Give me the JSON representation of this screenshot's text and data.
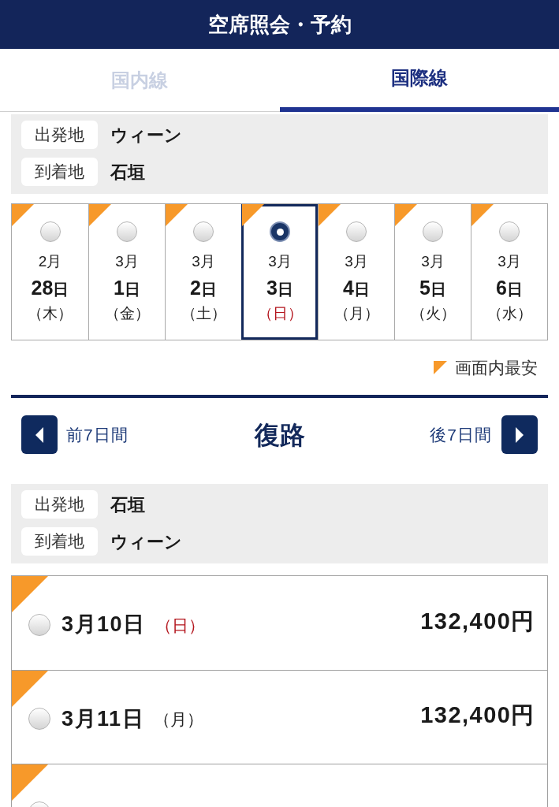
{
  "header": {
    "title": "空席照会・予約"
  },
  "tabs": [
    {
      "label": "国内線",
      "selected": false
    },
    {
      "label": "国際線",
      "selected": true
    }
  ],
  "outbound": {
    "route": [
      {
        "label": "出発地",
        "value": "ウィーン"
      },
      {
        "label": "到着地",
        "value": "石垣"
      }
    ],
    "dates": [
      {
        "month": "2月",
        "day": "28",
        "day_unit": "日",
        "weekday": "（木）",
        "holiday": false,
        "cheapest": true,
        "selected": false
      },
      {
        "month": "3月",
        "day": "1",
        "day_unit": "日",
        "weekday": "（金）",
        "holiday": false,
        "cheapest": true,
        "selected": false
      },
      {
        "month": "3月",
        "day": "2",
        "day_unit": "日",
        "weekday": "（土）",
        "holiday": false,
        "cheapest": true,
        "selected": false
      },
      {
        "month": "3月",
        "day": "3",
        "day_unit": "日",
        "weekday": "（日）",
        "holiday": true,
        "cheapest": true,
        "selected": true
      },
      {
        "month": "3月",
        "day": "4",
        "day_unit": "日",
        "weekday": "（月）",
        "holiday": false,
        "cheapest": true,
        "selected": false
      },
      {
        "month": "3月",
        "day": "5",
        "day_unit": "日",
        "weekday": "（火）",
        "holiday": false,
        "cheapest": true,
        "selected": false
      },
      {
        "month": "3月",
        "day": "6",
        "day_unit": "日",
        "weekday": "（水）",
        "holiday": false,
        "cheapest": true,
        "selected": false
      }
    ]
  },
  "legend": {
    "label": "画面内最安"
  },
  "return": {
    "prev": "前7日間",
    "title": "復路",
    "next": "後7日間",
    "route": [
      {
        "label": "出発地",
        "value": "石垣"
      },
      {
        "label": "到着地",
        "value": "ウィーン"
      }
    ],
    "dates": [
      {
        "date": "3月10日",
        "weekday": "（日）",
        "holiday": true,
        "price": "132,400円",
        "cheapest": true,
        "selected": false
      },
      {
        "date": "3月11日",
        "weekday": "（月）",
        "holiday": false,
        "price": "132,400円",
        "cheapest": true,
        "selected": false
      },
      {
        "cheapest": true,
        "selected": false
      }
    ]
  }
}
